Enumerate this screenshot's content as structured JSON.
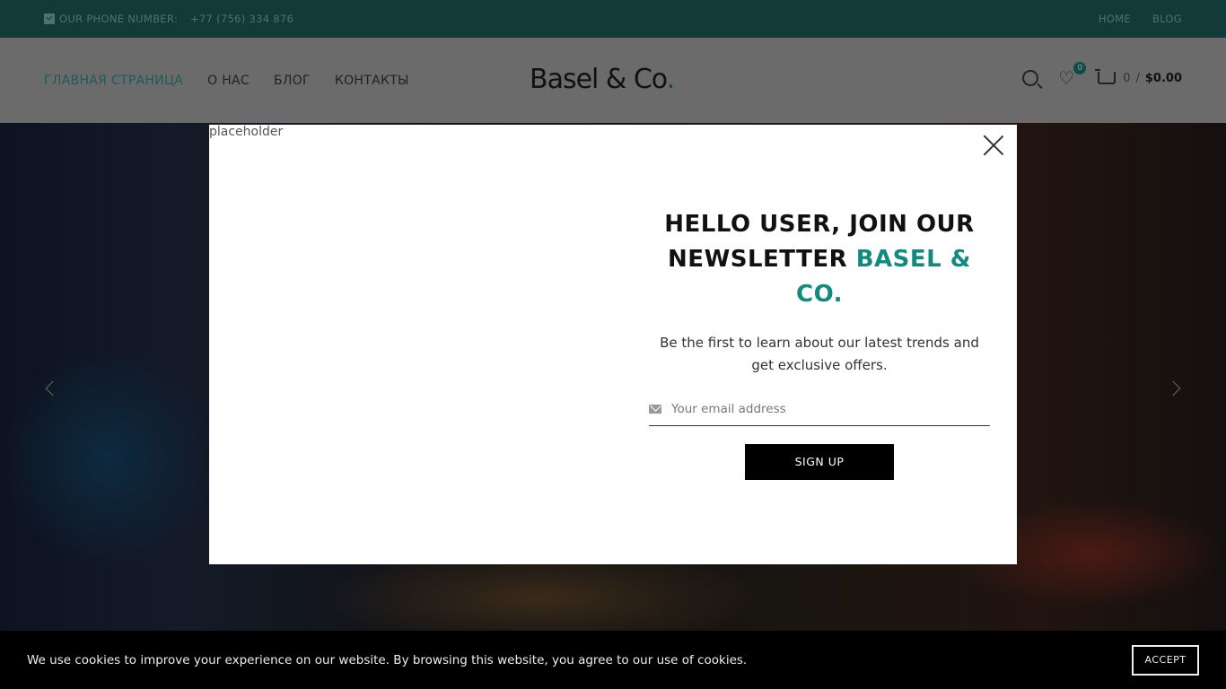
{
  "topbar": {
    "phone_label": "OUR PHONE NUMBER:",
    "phone_number": "+77 (756) 334 876",
    "links": [
      "HOME",
      "BLOG"
    ]
  },
  "header": {
    "nav": [
      "ГЛАВНАЯ СТРАНИЦА",
      "О НАС",
      "БЛОГ",
      "КОНТАКТЫ"
    ],
    "logo_text": "Basel & Co",
    "logo_dot": ".",
    "wishlist_count": "0",
    "cart_count": "0",
    "cart_separator": "/",
    "cart_total": "$0.00"
  },
  "modal": {
    "image_alt": "placeholder",
    "title_line1": "HELLO USER, JOIN OUR",
    "title_line2": "NEWSLETTER",
    "title_brand": "BASEL & CO.",
    "description": "Be the first to learn about our latest trends and get exclusive offers.",
    "email_placeholder": "Your email address",
    "signup_label": "SIGN UP"
  },
  "cookie": {
    "text": "We use cookies to improve your experience on our website. By browsing this website, you agree to our use of cookies.",
    "accept_label": "ACCEPT"
  },
  "colors": {
    "topbar_bg": "#123a38",
    "brand_accent": "#138a7f",
    "header_bg_dimmed": "#6b6b6b"
  }
}
